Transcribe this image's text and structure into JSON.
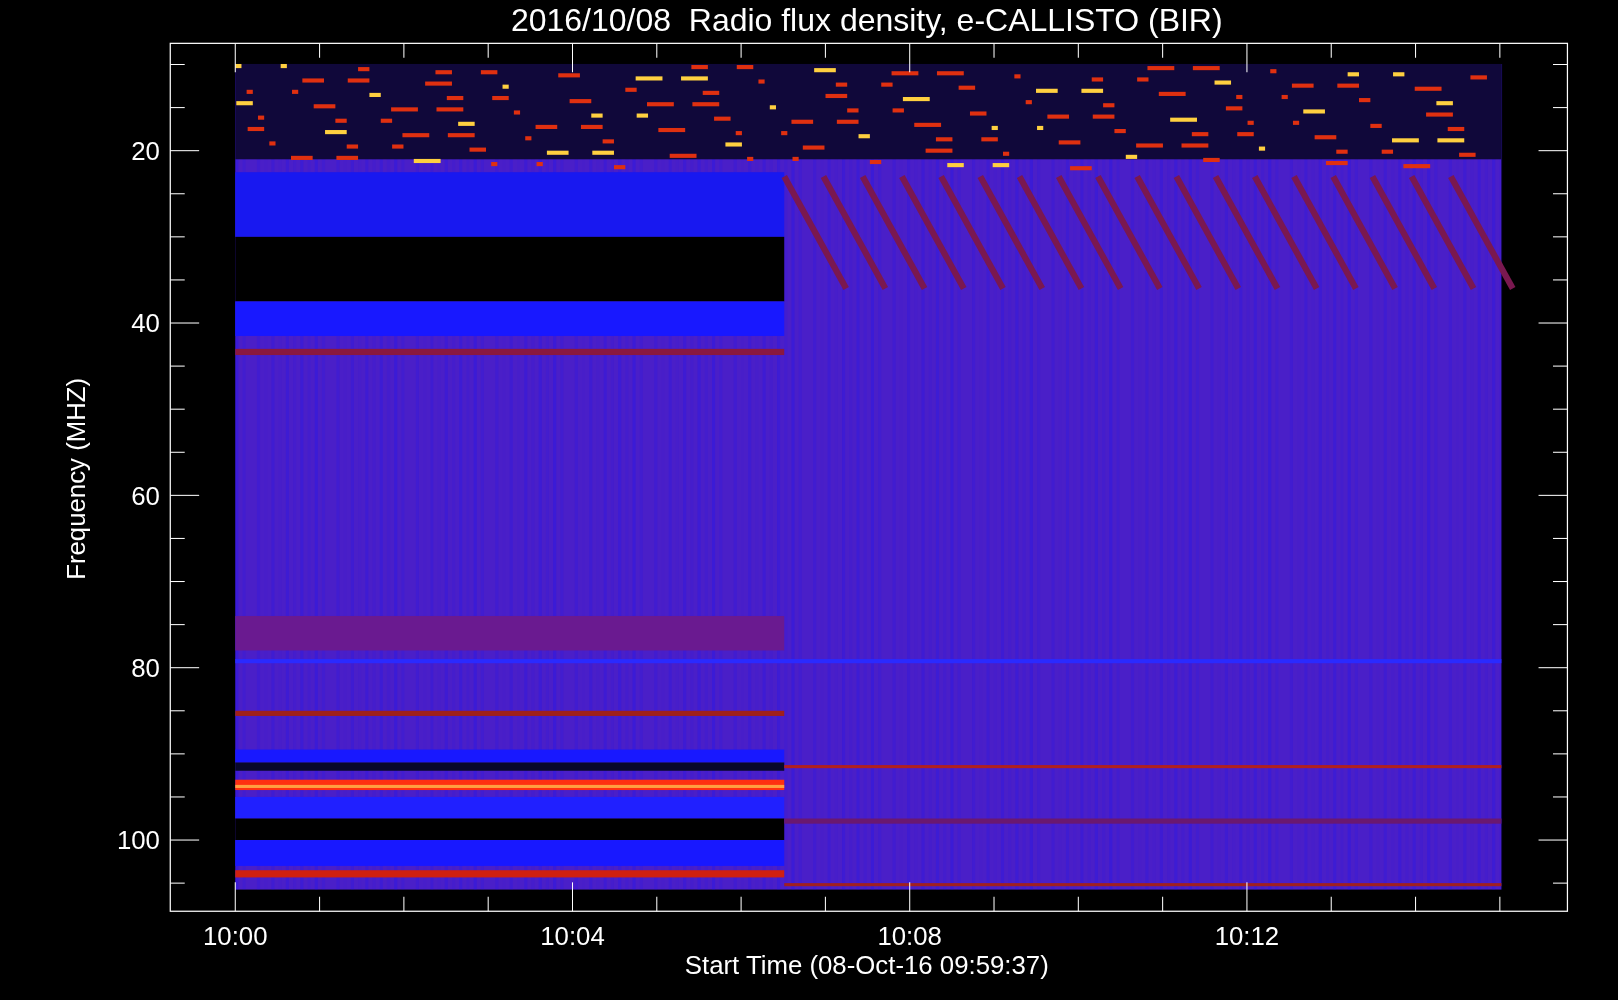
{
  "title": "2016/10/08  Radio flux density, e-CALLISTO (BIR)",
  "y_axis": {
    "label": "Frequency (MHZ)",
    "ticks": [
      "20",
      "40",
      "60",
      "80",
      "100"
    ]
  },
  "x_axis": {
    "label": "Start Time (08-Oct-16 09:59:37)",
    "ticks": [
      "10:00",
      "10:04",
      "10:08",
      "10:12"
    ]
  }
}
